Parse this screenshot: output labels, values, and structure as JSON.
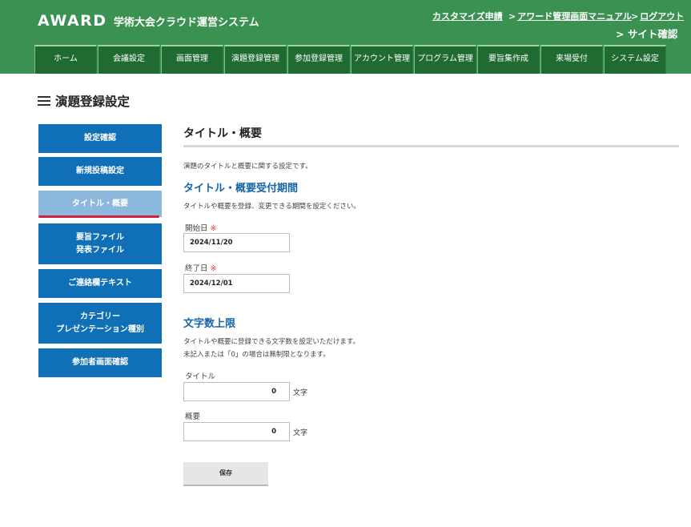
{
  "header": {
    "logo": "AWARD",
    "system_name": "学術大会クラウド運営システム",
    "links": [
      {
        "label": "カスタマイズ申請"
      },
      {
        "label": "アワード管理画面マニュアル"
      },
      {
        "label": "ログアウト"
      }
    ],
    "site_check": "サイト確認",
    "bg_color": "#3a9152"
  },
  "nav": {
    "tabs": [
      {
        "label": "ホーム"
      },
      {
        "label": "会議設定"
      },
      {
        "label": "画面管理"
      },
      {
        "label": "演題登録管理"
      },
      {
        "label": "参加登録管理"
      },
      {
        "label": "アカウント管理"
      },
      {
        "label": "プログラム管理"
      },
      {
        "label": "要旨集作成"
      },
      {
        "label": "来場受付"
      },
      {
        "label": "システム設定"
      }
    ]
  },
  "page": {
    "title": "演題登録設定"
  },
  "sidebar": {
    "items": [
      {
        "lines": [
          "設定確認"
        ]
      },
      {
        "lines": [
          "新規投稿設定"
        ]
      },
      {
        "lines": [
          "タイトル・概要"
        ],
        "active": true
      },
      {
        "lines": [
          "要旨ファイル",
          "発表ファイル"
        ]
      },
      {
        "lines": [
          "ご連絡欄テキスト"
        ]
      },
      {
        "lines": [
          "カテゴリー",
          "プレゼンテーション種別"
        ]
      },
      {
        "lines": [
          "参加者画面確認"
        ]
      }
    ],
    "accent_color": "#0f6fb7",
    "active_color": "#8db8dd",
    "active_underline_color": "#d3213f"
  },
  "main": {
    "section_title": "タイトル・概要",
    "intro": "演題のタイトルと概要に関する設定です。",
    "period": {
      "heading": "タイトル・概要受付期間",
      "description": "タイトルや概要を登録、変更できる期間を設定ください。",
      "start_label": "開始日",
      "start_value": "2024/11/20",
      "end_label": "終了日",
      "end_value": "2024/12/01",
      "required_mark": "※"
    },
    "limits": {
      "heading": "文字数上限",
      "description_line1": "タイトルや概要に登録できる文字数を設定いただけます。",
      "description_line2": "未記入または「0」の場合は無制限となります。",
      "title_label": "タイトル",
      "title_value": "0",
      "abstract_label": "概要",
      "abstract_value": "0",
      "unit": "文字"
    },
    "save_label": "保存"
  }
}
